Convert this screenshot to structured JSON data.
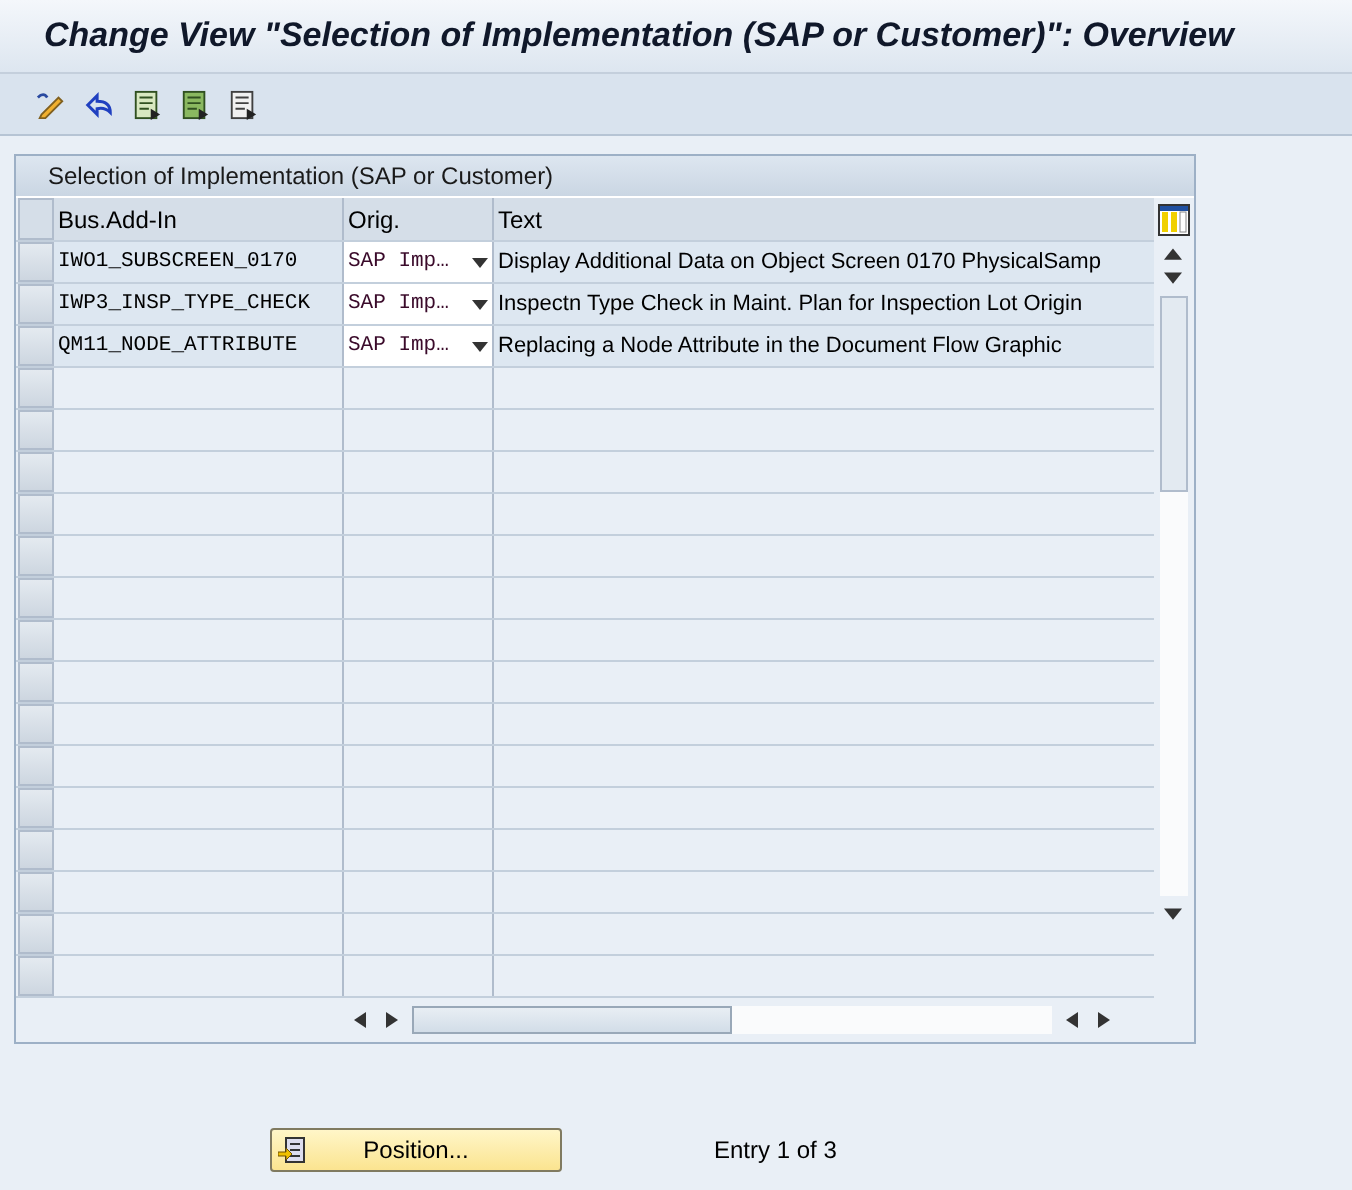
{
  "window": {
    "title": "Change View \"Selection of Implementation (SAP or Customer)\": Overview"
  },
  "table": {
    "title": "Selection of Implementation (SAP or Customer)",
    "columns": [
      "Bus.Add-In",
      "Orig.",
      "Text"
    ],
    "rows": [
      {
        "bus_add_in": "IWO1_SUBSCREEN_0170",
        "orig": "SAP Imp…",
        "text": "Display Additional Data on Object Screen 0170 PhysicalSamp"
      },
      {
        "bus_add_in": "IWP3_INSP_TYPE_CHECK",
        "orig": "SAP Imp…",
        "text": "Inspectn Type Check in Maint. Plan for Inspection Lot Origin"
      },
      {
        "bus_add_in": "QM11_NODE_ATTRIBUTE",
        "orig": "SAP Imp…",
        "text": "Replacing a Node Attribute in the Document Flow Graphic"
      }
    ]
  },
  "footer": {
    "button": "Position...",
    "entry": "Entry 1 of 3"
  }
}
